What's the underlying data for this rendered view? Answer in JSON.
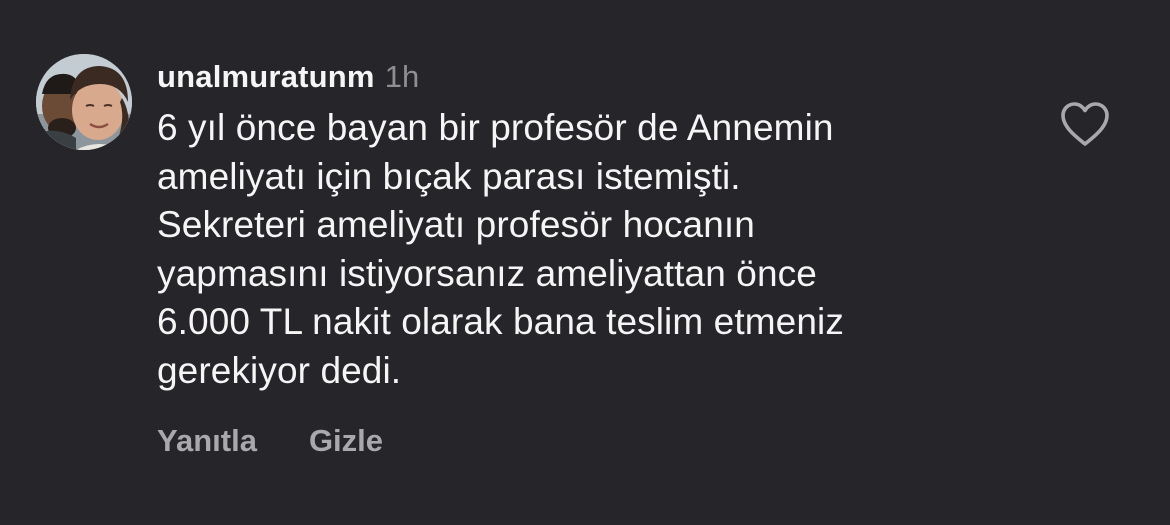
{
  "comment": {
    "username": "unalmuratunm",
    "time": "1h",
    "text": "6 yıl önce bayan bir profesör de Annemin\nameliyatı için bıçak parası istemişti.\nSekreteri ameliyatı profesör hocanın\nyapmasını istiyorsanız ameliyattan önce\n6.000 TL nakit olarak bana teslim etmeniz\ngerekiyor dedi.",
    "actions": {
      "reply_label": "Yanıtla",
      "hide_label": "Gizle"
    }
  },
  "icons": {
    "like": "heart-outline-icon"
  },
  "colors": {
    "background": "#26262a",
    "text_primary": "#f5f5f5",
    "text_secondary": "#8e8e93",
    "action_text": "#a8a8ad"
  }
}
